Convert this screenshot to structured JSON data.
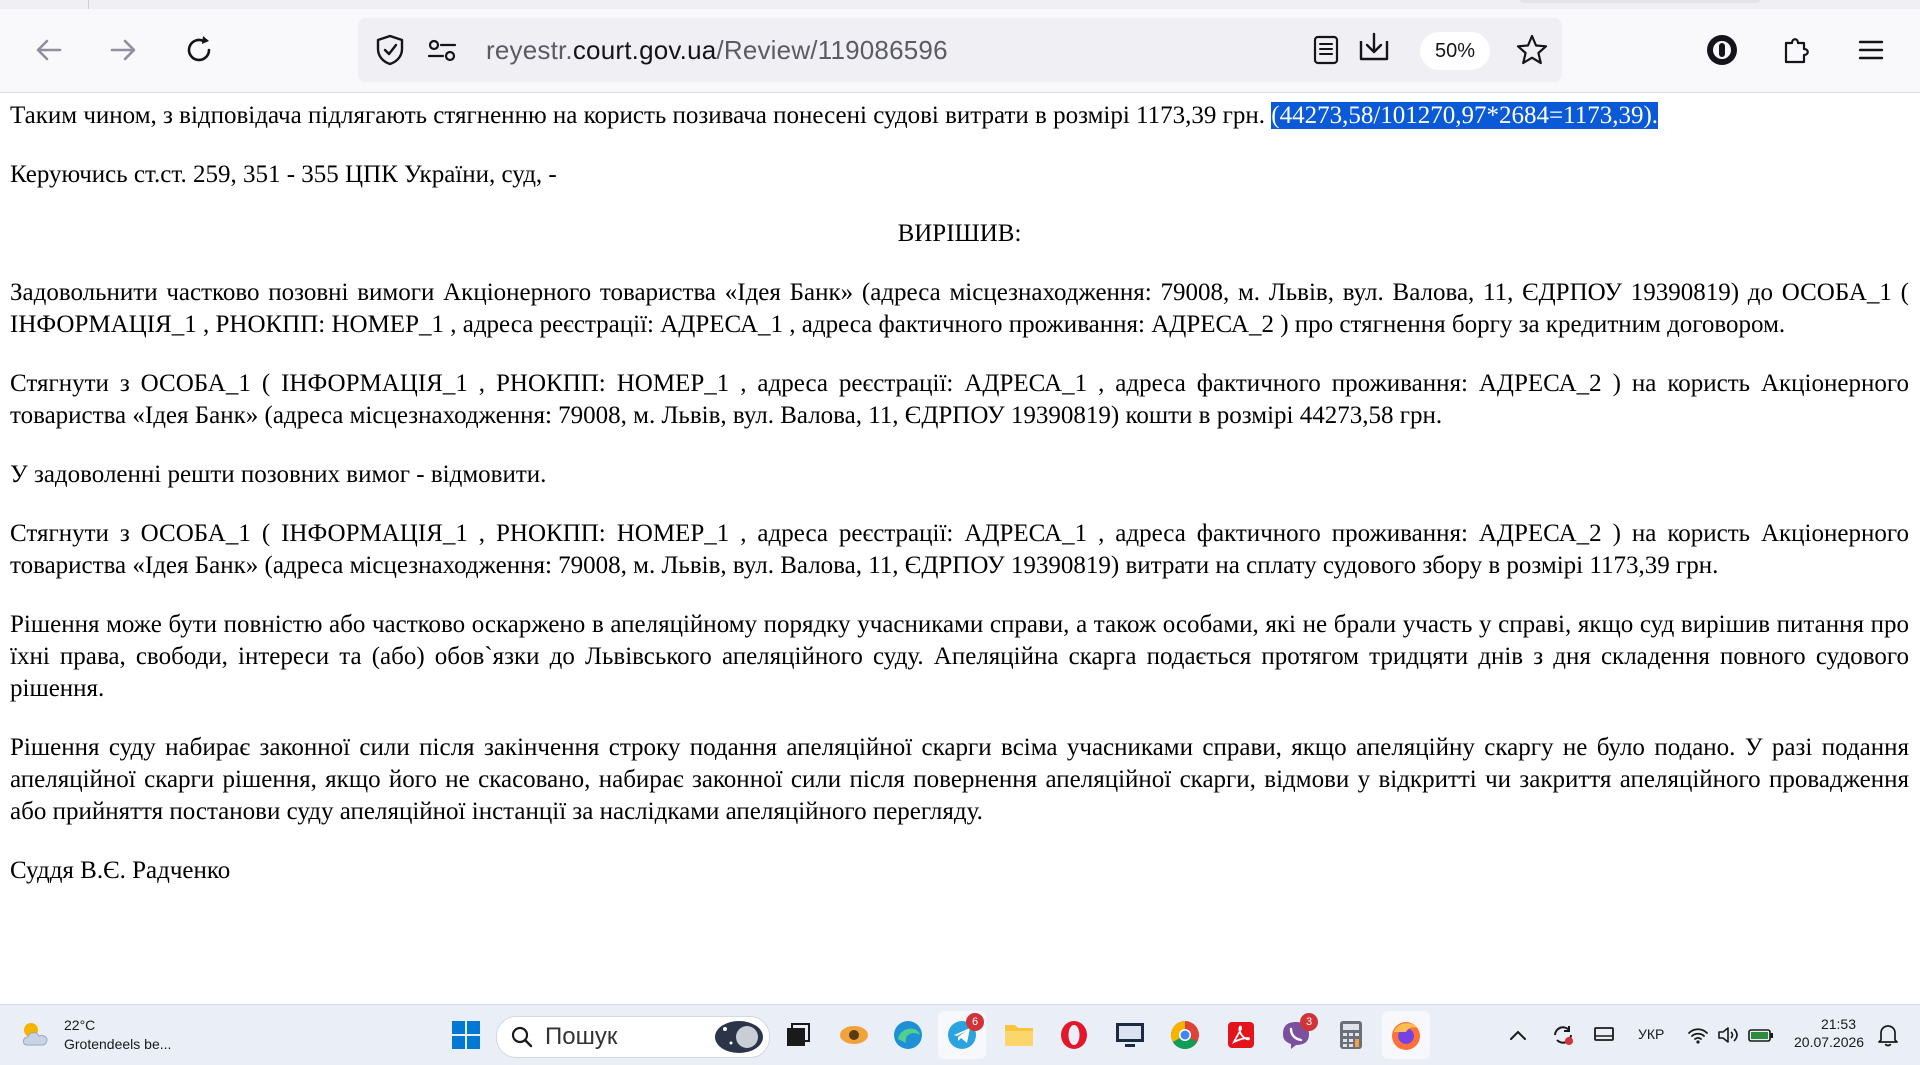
{
  "browser": {
    "url_prefix": "reyestr.",
    "url_host": "court.gov.ua",
    "url_path": "/Review/119086596",
    "zoom": "50%"
  },
  "document": {
    "para1_text": "Таким чином, з відповідача підлягають стягненню на користь позивача понесені судові витрати в розмірі 1173,39 грн. ",
    "para1_selected": "(44273,58/101270,97*2684=1173,39). ",
    "para2": "Керуючись ст.ст. 259, 351 - 355 ЦПК України, суд, -",
    "heading": "ВИРІШИВ:",
    "para3": "Задовольнити частково позовні вимоги Акціонерного товариства «Ідея Банк» (адреса місцезнаходження: 79008, м. Львів, вул. Валова, 11, ЄДРПОУ 19390819) до ОСОБА_1 ( ІНФОРМАЦІЯ_1 , РНОКПП: НОМЕР_1 , адреса реєстрації: АДРЕСА_1 , адреса фактичного проживання: АДРЕСА_2 ) про стягнення боргу за кредитним договором.",
    "para4": "Стягнути з ОСОБА_1 ( ІНФОРМАЦІЯ_1 , РНОКПП: НОМЕР_1 , адреса реєстрації: АДРЕСА_1 , адреса фактичного проживання: АДРЕСА_2 ) на користь Акціонерного товариства «Ідея Банк» (адреса місцезнаходження: 79008, м. Львів, вул. Валова, 11, ЄДРПОУ 19390819) кошти в розмірі 44273,58 грн.",
    "para5": "У задоволенні решти позовних вимог - відмовити.",
    "para6": "Стягнути з ОСОБА_1 ( ІНФОРМАЦІЯ_1 , РНОКПП: НОМЕР_1 , адреса реєстрації: АДРЕСА_1 , адреса фактичного проживання: АДРЕСА_2 ) на користь Акціонерного товариства «Ідея Банк» (адреса місцезнаходження: 79008, м. Львів, вул. Валова, 11, ЄДРПОУ 19390819) витрати на сплату судового збору в розмірі 1173,39 грн.",
    "para7": "Рішення може бути повністю або частково оскаржено в апеляційному порядку учасниками справи, а також особами, які не брали участь у справі, якщо суд вирішив питання про їхні права, свободи, інтереси та (або) обов`язки до Львівського апеляційного суду. Апеляційна скарга подається протягом тридцяти днів з дня складення повного судового рішення.",
    "para8": "Рішення суду набирає законної сили після закінчення строку подання апеляційної скарги всіма учасниками справи, якщо апеляційну скаргу не було подано. У разі подання апеляційної скарги рішення, якщо його не скасовано, набирає законної сили після повернення апеляційної скарги, відмови у відкритті чи закриття апеляційного провадження або прийняття постанови суду апеляційної інстанції за наслідками апеляційного перегляду.",
    "signature": "Суддя В.Є. Радченко"
  },
  "taskbar": {
    "weather_temp": "22°C",
    "weather_desc": "Grotendeels be...",
    "search_label": "Пошук",
    "telegram_badge": "6",
    "viber_badge": "3",
    "lang": "УКР",
    "time": "21:53",
    "date": "20.07.2026"
  },
  "colors": {
    "selection": "#0a5ad8",
    "chrome": "#f9f9fb",
    "urlbar": "#f0f0f4",
    "taskbar": "#e9eef7"
  }
}
